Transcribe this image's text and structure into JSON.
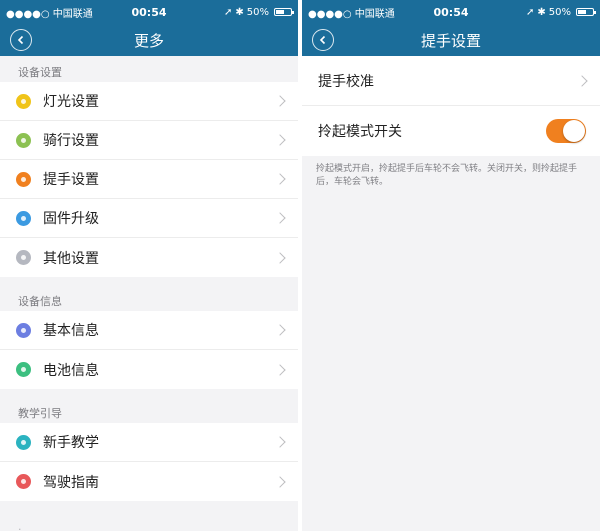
{
  "status_bar": {
    "carrier": "●●●●○ 中国联通 ",
    "time": "00:54",
    "battery": "50%"
  },
  "left": {
    "nav_title": "更多",
    "sections": [
      {
        "header": "设备设置",
        "items": [
          {
            "label": "灯光设置",
            "icon": "light-icon",
            "color": "#f0c419"
          },
          {
            "label": "骑行设置",
            "icon": "ride-icon",
            "color": "#8cc152"
          },
          {
            "label": "提手设置",
            "icon": "handle-icon",
            "color": "#f0801f"
          },
          {
            "label": "固件升级",
            "icon": "firmware-icon",
            "color": "#3b9ae1"
          },
          {
            "label": "其他设置",
            "icon": "other-icon",
            "color": "#b5b8c0"
          }
        ]
      },
      {
        "header": "设备信息",
        "items": [
          {
            "label": "基本信息",
            "icon": "info-icon",
            "color": "#6c7ee1"
          },
          {
            "label": "电池信息",
            "icon": "battery-icon",
            "color": "#3cbf80"
          }
        ]
      },
      {
        "header": "教学引导",
        "items": [
          {
            "label": "新手教学",
            "icon": "tutorial-icon",
            "color": "#2bb3c0"
          },
          {
            "label": "驾驶指南",
            "icon": "guide-icon",
            "color": "#e8585a"
          }
        ]
      }
    ]
  },
  "right": {
    "nav_title": "提手设置",
    "calibrate_label": "提手校准",
    "lift_mode_label": "拎起模式开关",
    "lift_mode_on": true,
    "note": "拎起模式开启，拎起提手后车轮不会飞转。关闭开关，则拎起提手后，车轮会飞转。"
  }
}
